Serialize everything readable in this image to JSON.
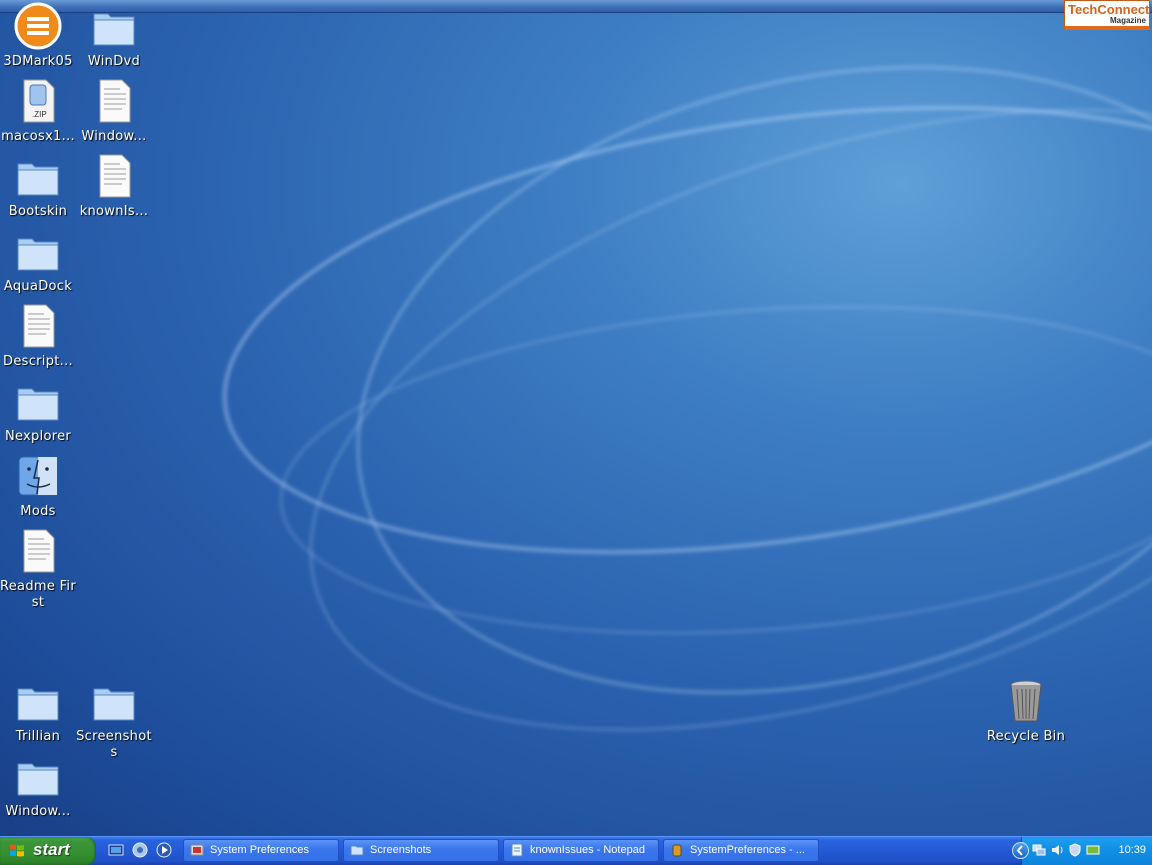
{
  "desktop": {
    "icons": [
      {
        "label": "3DMark05",
        "icon": "3dmark-icon"
      },
      {
        "label": "WinDvd",
        "icon": "folder-icon"
      },
      {
        "label": "macosx1...",
        "icon": "zip-file-icon"
      },
      {
        "label": "Window...",
        "icon": "text-document-icon"
      },
      {
        "label": "Bootskin",
        "icon": "folder-icon"
      },
      {
        "label": "knownIs...",
        "icon": "text-document-icon"
      },
      {
        "label": "AquaDock",
        "icon": "folder-icon"
      },
      {
        "label": "Descript...",
        "icon": "text-document-icon"
      },
      {
        "label": "Nexplorer",
        "icon": "folder-icon"
      },
      {
        "label": "Mods",
        "icon": "finder-icon"
      },
      {
        "label": "Readme First",
        "icon": "text-document-icon"
      },
      {
        "label": "Trillian",
        "icon": "folder-icon"
      },
      {
        "label": "Screenshots",
        "icon": "folder-icon"
      },
      {
        "label": "Window...",
        "icon": "folder-icon"
      },
      {
        "label": "Recycle Bin",
        "icon": "trash-icon"
      }
    ]
  },
  "watermark": {
    "brand": "TechConnect",
    "sub": "Magazine"
  },
  "taskbar": {
    "start_label": "start",
    "tasks": [
      {
        "label": "System Preferences",
        "icon": "preferences-icon"
      },
      {
        "label": "Screenshots",
        "icon": "folder-icon"
      },
      {
        "label": "knownIssues - Notepad",
        "icon": "notepad-icon"
      },
      {
        "label": "SystemPreferences - ...",
        "icon": "app-icon"
      }
    ],
    "clock": "10:39"
  },
  "colors": {
    "desktop": "#2b63b0",
    "taskbar": "#2459d4",
    "start": "#3a9638",
    "tray": "#1290e6"
  }
}
